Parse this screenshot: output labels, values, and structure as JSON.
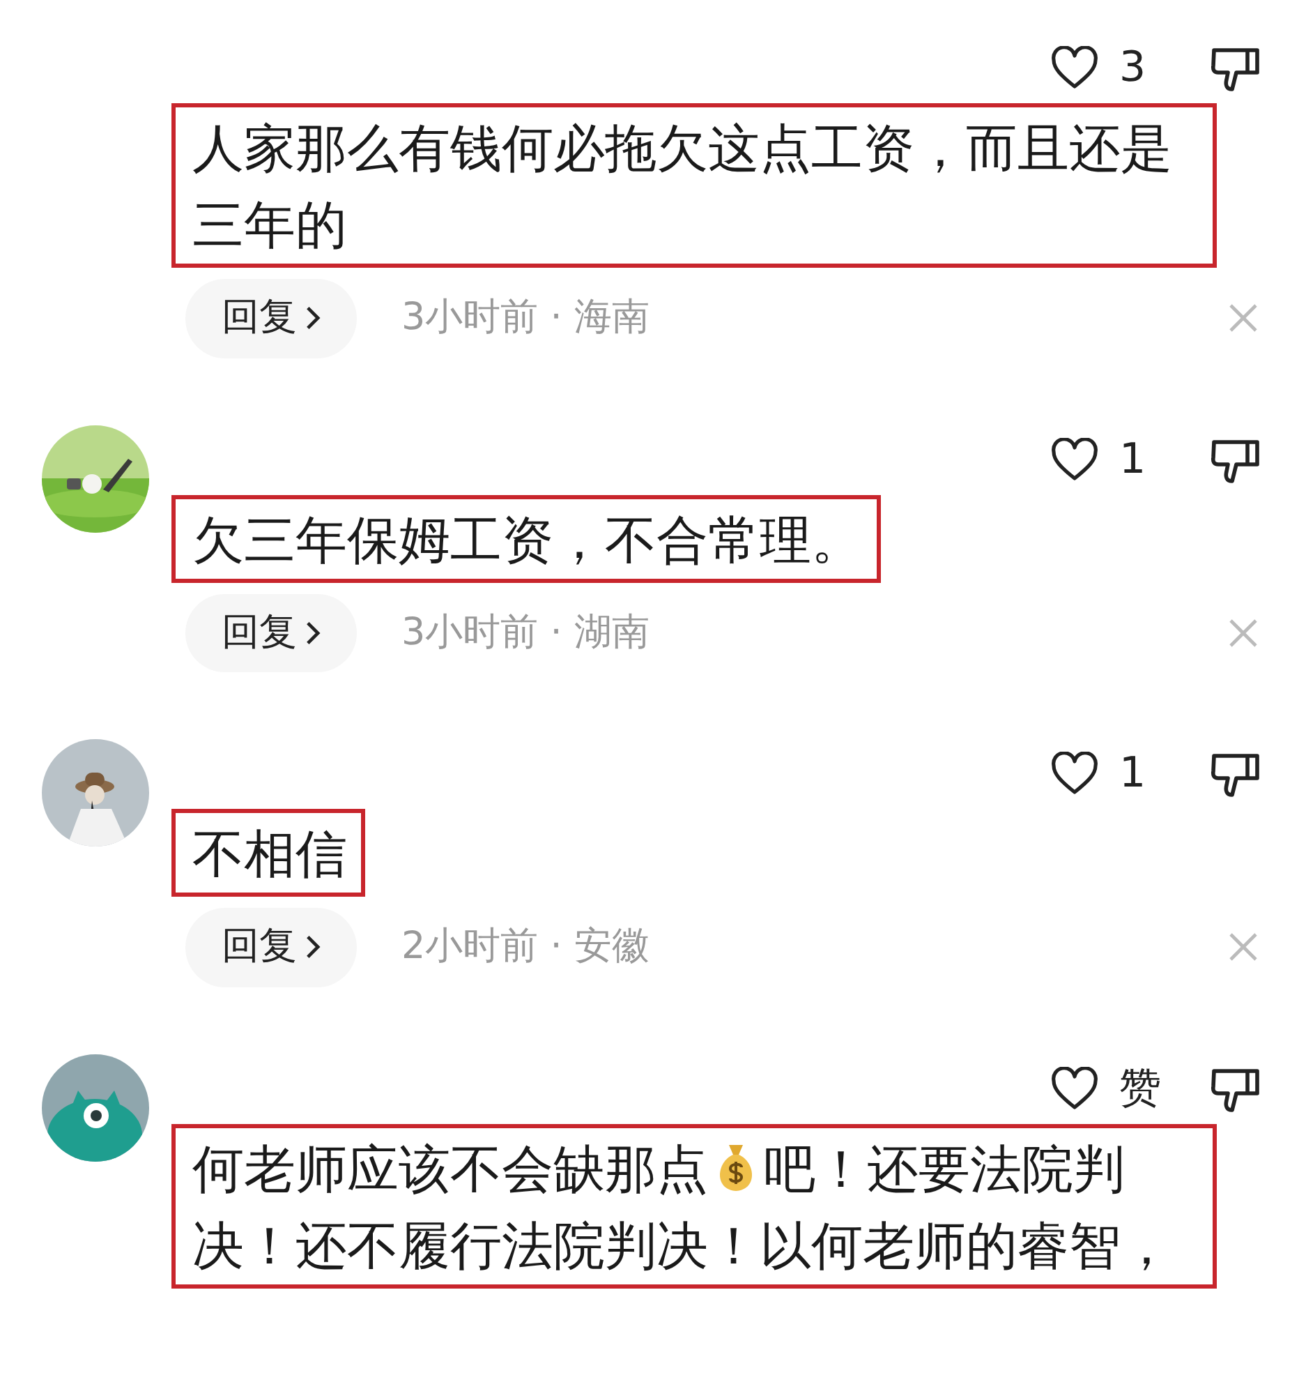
{
  "comments": [
    {
      "likes": "3",
      "highlighted": true,
      "text_parts": [
        {
          "kind": "text",
          "text": "人家那么有钱何必拖欠这点工资，而且还是三年的"
        }
      ],
      "reply_label": "回复",
      "meta": "3小时前 · 海南"
    },
    {
      "likes": "1",
      "highlighted": true,
      "text_parts": [
        {
          "kind": "text",
          "text": "欠三年保姆工资，不合常理。"
        }
      ],
      "reply_label": "回复",
      "meta": "3小时前 · 湖南"
    },
    {
      "likes": "1",
      "highlighted": true,
      "text_parts": [
        {
          "kind": "text",
          "text": "不相信"
        }
      ],
      "reply_label": "回复",
      "meta": "2小时前 · 安徽"
    },
    {
      "likes": "赞",
      "highlighted": true,
      "text_parts": [
        {
          "kind": "text",
          "text": "何老师应该不会缺那点"
        },
        {
          "kind": "money_bag"
        },
        {
          "kind": "text",
          "text": "吧！还要法院判"
        },
        {
          "kind": "text",
          "text": "决！还不履行法院判决！以何老师的睿智，"
        }
      ]
    }
  ]
}
